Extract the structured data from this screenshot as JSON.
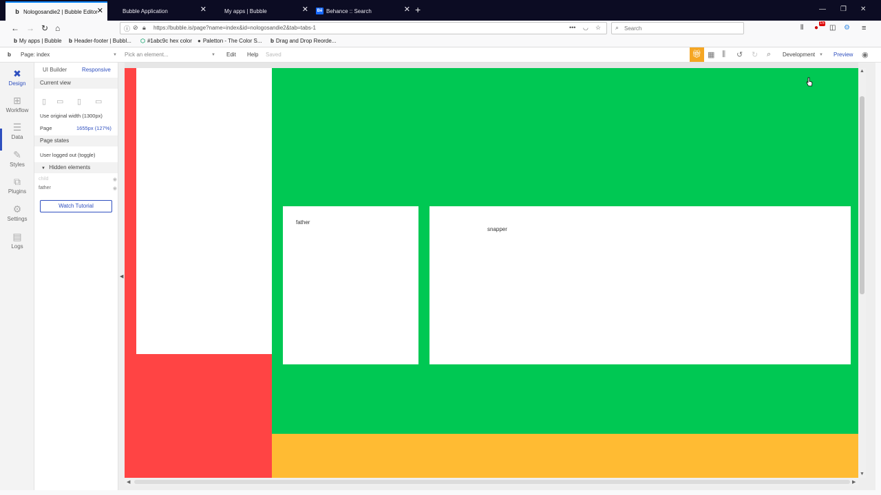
{
  "browser": {
    "tabs": [
      {
        "title": "Nologosandie2 | Bubble Editor",
        "favicon": "bubble-icon",
        "active": true
      },
      {
        "title": "Bubble Application",
        "favicon": "none",
        "active": false
      },
      {
        "title": "My apps | Bubble",
        "favicon": "none",
        "active": false
      },
      {
        "title": "Behance :: Search",
        "favicon": "behance-icon",
        "active": false
      }
    ],
    "new_tab": "+",
    "close_glyph": "✕",
    "url": "https://bubble.is/page?name=index&id=nologosandie2&tab=tabs-1",
    "search_placeholder": "Search",
    "bookmarks": [
      {
        "label": "My apps | Bubble",
        "icon": "b"
      },
      {
        "label": "Header-footer | Bubbl...",
        "icon": "b"
      },
      {
        "label": "#1abc9c hex color",
        "icon": "⬡"
      },
      {
        "label": "Paletton - The Color S...",
        "icon": "●"
      },
      {
        "label": "Drag and Drop Reorde...",
        "icon": "b"
      }
    ],
    "badge_count": "15"
  },
  "editor_bar": {
    "page_selector": "Page: index",
    "element_picker_placeholder": "Pick an element...",
    "edit": "Edit",
    "help": "Help",
    "saved": "Saved",
    "environment": "Development",
    "preview": "Preview"
  },
  "rail": [
    {
      "label": "Design",
      "icon": "design-icon",
      "active": true
    },
    {
      "label": "Workflow",
      "icon": "workflow-icon",
      "active": false
    },
    {
      "label": "Data",
      "icon": "data-icon",
      "active": false
    },
    {
      "label": "Styles",
      "icon": "styles-icon",
      "active": false
    },
    {
      "label": "Plugins",
      "icon": "plugins-icon",
      "active": false
    },
    {
      "label": "Settings",
      "icon": "settings-icon",
      "active": false
    },
    {
      "label": "Logs",
      "icon": "logs-icon",
      "active": false
    }
  ],
  "panel": {
    "tabs": [
      "UI Builder",
      "Responsive"
    ],
    "current_view": "Current view",
    "use_original_width": "Use original width (1300px)",
    "page_label": "Page",
    "page_value": "1655px (127%)",
    "page_states": "Page states",
    "user_logged_out": "User logged out (toggle)",
    "hidden_elements": "Hidden elements",
    "hidden_items": [
      "child",
      "father"
    ],
    "watch_tutorial": "Watch Tutorial"
  },
  "canvas": {
    "colors": {
      "red": "#ff4444",
      "green": "#00c853",
      "orange": "#ffbb33",
      "white": "#ffffff"
    },
    "labels": {
      "father": "father",
      "snapper": "snapper"
    }
  }
}
